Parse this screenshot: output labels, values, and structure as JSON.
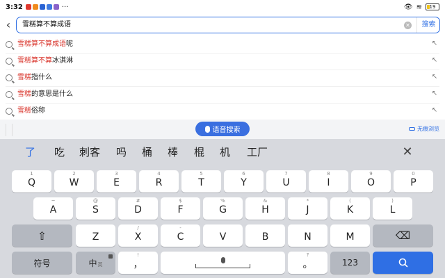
{
  "status_bar": {
    "time": "3:32",
    "more": "···",
    "battery": "19",
    "notif_colors": [
      "#e0392e",
      "#f08a1c",
      "#2a63d4",
      "#3f7be0",
      "#8a62c9"
    ]
  },
  "search": {
    "query": "雪糕算不算成语",
    "button_label": "搜索"
  },
  "suggestions": [
    {
      "highlight": "雪糕算不算成语",
      "rest": "呢"
    },
    {
      "highlight": "雪糕算不算",
      "rest": "冰淇淋"
    },
    {
      "highlight": "雪糕",
      "rest": "指什么"
    },
    {
      "highlight": "雪糕",
      "rest": "的意思是什么"
    },
    {
      "highlight": "雪糕",
      "rest": "俗称"
    }
  ],
  "voice_search": {
    "label": "语音搜索"
  },
  "incognito": {
    "label": "无痕浏览"
  },
  "keyboard": {
    "candidates": [
      "了",
      "吃",
      "刺客",
      "吗",
      "桶",
      "棒",
      "棍",
      "机",
      "工厂"
    ],
    "row1": [
      {
        "hint": "1",
        "key": "Q"
      },
      {
        "hint": "2",
        "key": "W"
      },
      {
        "hint": "3",
        "key": "E"
      },
      {
        "hint": "4",
        "key": "R"
      },
      {
        "hint": "5",
        "key": "T"
      },
      {
        "hint": "6",
        "key": "Y"
      },
      {
        "hint": "7",
        "key": "U"
      },
      {
        "hint": "8",
        "key": "I"
      },
      {
        "hint": "9",
        "key": "O"
      },
      {
        "hint": "0",
        "key": "P"
      }
    ],
    "row2": [
      {
        "hint": "~",
        "key": "A"
      },
      {
        "hint": "@",
        "key": "S"
      },
      {
        "hint": "#",
        "key": "D"
      },
      {
        "hint": "$",
        "key": "F"
      },
      {
        "hint": "%",
        "key": "G"
      },
      {
        "hint": "&",
        "key": "H"
      },
      {
        "hint": "*",
        "key": "J"
      },
      {
        "hint": "(",
        "key": "K"
      },
      {
        "hint": ")",
        "key": "L"
      }
    ],
    "row3": [
      {
        "hint": "",
        "key": "Z"
      },
      {
        "hint": "/",
        "key": "X"
      },
      {
        "hint": "-",
        "key": "C"
      },
      {
        "hint": "",
        "key": "V"
      },
      {
        "hint": "",
        "key": "B"
      },
      {
        "hint": "",
        "key": "N"
      },
      {
        "hint": "",
        "key": "M"
      }
    ],
    "symbols_label": "符号",
    "lang_label": "中",
    "lang_sub": "英",
    "comma_hint": "!",
    "comma": "，",
    "period_hint": "?",
    "period": "。",
    "num_label": "123"
  }
}
